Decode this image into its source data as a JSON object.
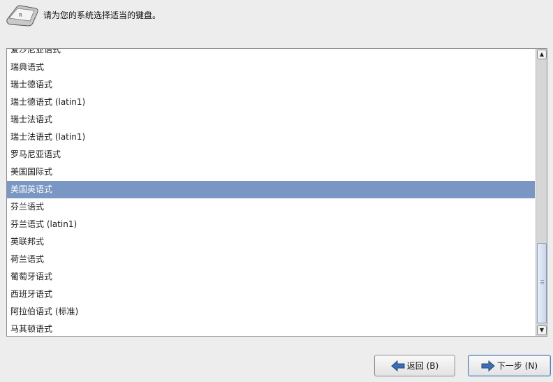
{
  "header": {
    "icon": "keyboard-icon",
    "prompt": "请为您的系统选择适当的键盘。"
  },
  "keyboard_list": {
    "items": [
      "爱沙尼亚语式",
      "瑞典语式",
      "瑞士德语式",
      "瑞士德语式 (latin1)",
      "瑞士法语式",
      "瑞士法语式 (latin1)",
      "罗马尼亚语式",
      "美国国际式",
      "美国英语式",
      "芬兰语式",
      "芬兰语式 (latin1)",
      "英联邦式",
      "荷兰语式",
      "葡萄牙语式",
      "西班牙语式",
      "阿拉伯语式 (标准)",
      "马其顿语式"
    ],
    "selected": "美国英语式",
    "selection_color": "#7a96c2"
  },
  "buttons": {
    "back_label": "返回 (B)",
    "next_label": "下一步 (N)"
  }
}
